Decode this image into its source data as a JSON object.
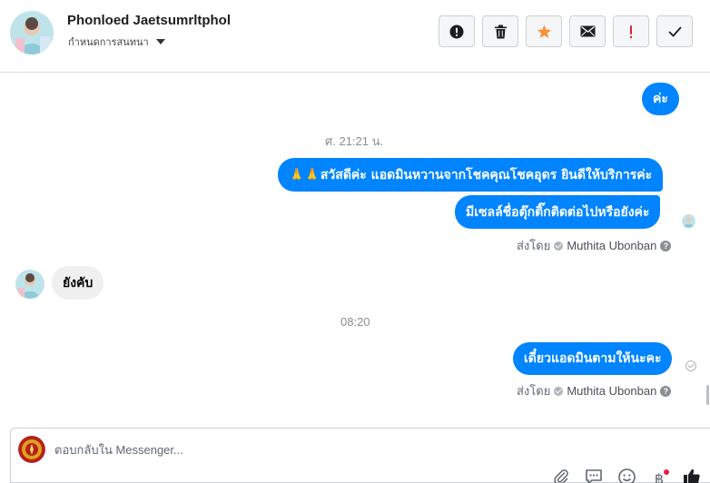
{
  "header": {
    "contact_name": "Phonloed Jaetsumrltphol",
    "assign_label": "กำหนดการสนทนา",
    "actions": [
      {
        "icon": "alert-circle-icon",
        "name": "mark-spam-button"
      },
      {
        "icon": "trash-icon",
        "name": "delete-button"
      },
      {
        "icon": "star-icon",
        "name": "star-button"
      },
      {
        "icon": "envelope-icon",
        "name": "mark-unread-button"
      },
      {
        "icon": "exclamation-icon",
        "name": "follow-up-button"
      },
      {
        "icon": "check-icon",
        "name": "mark-done-button"
      }
    ]
  },
  "messages": {
    "m1": "ค่ะ",
    "time1": "ศ. 21:21 น.",
    "m2": "🙏🙏สวัสดีค่ะ แอดมินหวานจากโชคคุณโชคอุดร ยินดีให้บริการค่ะ",
    "m3": "มีเซลล์ชื่อตุ๊กติ๊กติดต่อไปหรือยังค่ะ",
    "sent_by_1": {
      "label": "ส่งโดย",
      "agent": "Muthita Ubonban"
    },
    "m4": "ยังคับ",
    "time2": "08:20",
    "m5": "เดี๋ยวแอดมินตามให้นะคะ",
    "sent_by_2": {
      "label": "ส่งโดย",
      "agent": "Muthita Ubonban"
    }
  },
  "composer": {
    "placeholder": "ตอบกลับใน Messenger...",
    "icons": [
      "paperclip-icon",
      "saved-replies-icon",
      "emoji-icon",
      "baht-payment-icon",
      "like-icon"
    ]
  },
  "colors": {
    "outgoing_bubble": "#0084ff",
    "incoming_bubble": "#f0f0f0",
    "star": "#f7923a",
    "alert": "#e41e3f"
  }
}
